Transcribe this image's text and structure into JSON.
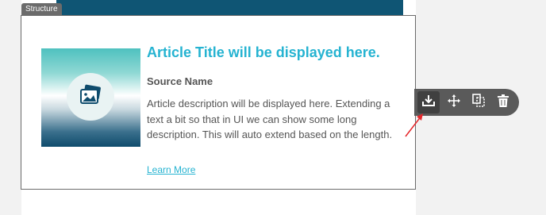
{
  "structure_tag": {
    "label": "Structure"
  },
  "article": {
    "title": "Article Title will be displayed here.",
    "source": "Source Name",
    "description": "Article description will be displayed here. Extending a text a bit so that in UI we can show some long description. This will auto extend based on the length.",
    "link_label": "Learn More",
    "thumbnail_icon": "image-stack-icon"
  },
  "toolbar": {
    "tools": [
      {
        "name": "save-block",
        "icon": "download-tray-icon",
        "active": true
      },
      {
        "name": "move",
        "icon": "move-arrows-icon",
        "active": false
      },
      {
        "name": "duplicate",
        "icon": "copy-icon",
        "active": false
      },
      {
        "name": "delete",
        "icon": "trash-icon",
        "active": false
      }
    ]
  },
  "colors": {
    "accent": "#25b3d1",
    "header_band": "#0f5574",
    "toolbar": "#5a5a5a",
    "annotation_arrow": "#e5262a"
  }
}
